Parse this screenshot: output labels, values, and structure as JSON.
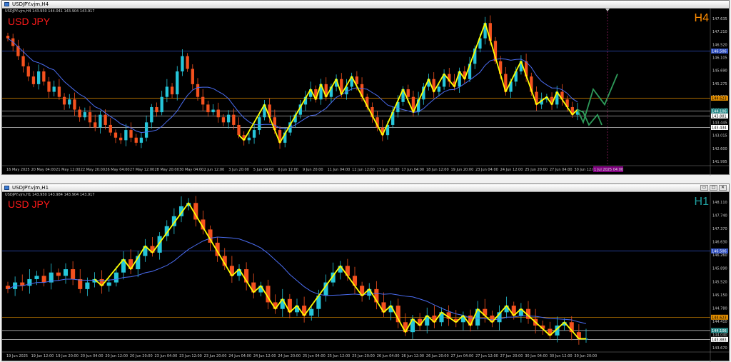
{
  "top": {
    "window_title": "USDJPY.vjm,H4",
    "ohlc": "USDJPY.vjm,H4  143.950 144.041 143.904 143.917",
    "symbol": "USD JPY",
    "timeframe": "H4",
    "timeframe_color": "#ff8c00",
    "price_ticks": [
      "147.635",
      "147.210",
      "146.520",
      "146.105",
      "145.690",
      "145.275",
      "144.860",
      "144.445",
      "143.445",
      "143.015",
      "142.600",
      "141.995"
    ],
    "price_tags": {
      "blue_line": "146.506",
      "orange_line": "144.623",
      "white_line1": "144.106",
      "white_line2": "143.881",
      "white_line3": "143.434"
    },
    "time_ticks": [
      "16 May 2025",
      "20 May 04:00",
      "21 May 12:00",
      "22 May 20:00",
      "26 May 04:00",
      "27 May 12:00",
      "28 May 20:00",
      "30 May 04:00",
      "2 Jun 12:00",
      "3 Jun 20:00",
      "5 Jun 04:00",
      "6 Jun 12:00",
      "9 Jun 20:00",
      "11 Jun 04:00",
      "12 Jun 12:00",
      "13 Jun 20:00",
      "17 Jun 04:00",
      "18 Jun 12:00",
      "19 Jun 20:00",
      "23 Jun 04:00",
      "24 Jun 12:00",
      "25 Jun 20:00",
      "27 Jun 04:00",
      "30 Jun 12:00"
    ],
    "time_tag": "1 Jul 2025 04:00",
    "close_button": ""
  },
  "bottom": {
    "window_title": "USDJPY.vjm,H1",
    "ohlc": "USDJPY.vjm,H1  143.950 143.984 143.904 143.917",
    "symbol": "USD JPY",
    "timeframe": "H1",
    "timeframe_color": "#20a0a0",
    "price_ticks": [
      "148.110",
      "147.740",
      "147.370",
      "146.630",
      "146.260",
      "145.890",
      "145.520",
      "145.150",
      "144.780",
      "144.410",
      "144.040",
      "143.670"
    ],
    "price_tags": {
      "blue_line": "146.506",
      "orange_line": "144.623",
      "white_line1": "144.106",
      "white_line2": "143.883"
    },
    "time_ticks": [
      "19 Jun 2025",
      "19 Jun 12:00",
      "19 Jun 20:00",
      "20 Jun 04:00",
      "20 Jun 12:00",
      "20 Jun 20:00",
      "23 Jun 04:00",
      "23 Jun 12:00",
      "23 Jun 20:00",
      "24 Jun 04:00",
      "24 Jun 12:00",
      "24 Jun 20:00",
      "25 Jun 04:00",
      "25 Jun 12:00",
      "25 Jun 20:00",
      "26 Jun 04:00",
      "26 Jun 12:00",
      "26 Jun 20:00",
      "27 Jun 04:00",
      "27 Jun 12:00",
      "27 Jun 20:00",
      "30 Jun 04:00",
      "30 Jun 12:00",
      "30 Jun 20:00"
    ],
    "win_buttons": [
      "▭",
      "□",
      "✕"
    ]
  },
  "colors": {
    "bull": "#26c6da",
    "bear": "#f4511e",
    "zigzag": "#ffff00",
    "ma": "#4a6cf0",
    "forecast": "#2e9b5a",
    "blue_level": "#3050c0",
    "orange_level": "#e08c00",
    "white_level": "#d0d0d0"
  },
  "top_price_series": [
    146.9,
    146.6,
    146.2,
    145.8,
    145.4,
    145.1,
    145.6,
    145.2,
    144.8,
    145.0,
    144.6,
    144.3,
    144.5,
    144.1,
    143.8,
    144.0,
    143.6,
    143.4,
    143.9,
    143.5,
    143.2,
    143.0,
    142.9,
    143.3,
    143.0,
    142.8,
    143.0,
    143.6,
    144.2,
    144.0,
    144.6,
    145.0,
    144.7,
    145.6,
    146.2,
    145.7,
    145.1,
    144.6,
    144.3,
    144.0,
    144.1,
    143.8,
    143.6,
    143.9,
    143.5,
    143.1,
    142.9,
    143.0,
    143.3,
    143.8,
    144.3,
    143.8,
    143.3,
    142.8,
    143.2,
    143.6,
    143.9,
    144.3,
    144.6,
    144.9,
    144.5,
    145.1,
    144.6,
    145.0,
    145.3,
    144.7,
    145.0,
    145.4,
    145.1,
    144.6,
    144.2,
    143.8,
    143.4,
    143.1,
    143.5,
    144.0,
    144.4,
    144.9,
    144.6,
    144.0,
    144.5,
    145.0,
    145.3,
    144.8,
    145.0,
    145.5,
    145.2,
    145.0,
    145.6,
    145.3,
    145.9,
    146.5,
    146.9,
    147.5,
    146.8,
    146.0,
    145.5,
    144.8,
    145.2,
    145.6,
    146.0,
    145.4,
    144.8,
    144.3,
    144.5,
    144.6,
    144.3,
    144.8,
    144.5,
    144.2,
    143.9,
    144.1
  ],
  "bottom_price_series": [
    145.4,
    145.6,
    145.5,
    145.7,
    145.8,
    145.6,
    145.9,
    145.8,
    146.0,
    145.7,
    145.4,
    145.6,
    145.7,
    145.5,
    145.6,
    145.9,
    146.3,
    146.0,
    146.4,
    146.7,
    146.5,
    147.0,
    147.3,
    147.6,
    147.9,
    148.0,
    147.5,
    147.2,
    146.8,
    146.4,
    146.1,
    145.8,
    146.0,
    145.6,
    145.3,
    145.5,
    145.0,
    144.8,
    145.1,
    144.7,
    144.9,
    144.6,
    144.8,
    145.2,
    145.6,
    145.9,
    146.1,
    145.8,
    145.5,
    145.2,
    145.4,
    145.0,
    144.7,
    144.9,
    144.4,
    144.1,
    144.5,
    144.3,
    144.6,
    144.4,
    144.7,
    144.5,
    144.4,
    144.6,
    144.3,
    144.8,
    144.6,
    144.4,
    144.7,
    144.9,
    144.6,
    144.8,
    144.5,
    144.3,
    144.2,
    144.0,
    144.3,
    144.4,
    144.1,
    143.9,
    143.9
  ]
}
